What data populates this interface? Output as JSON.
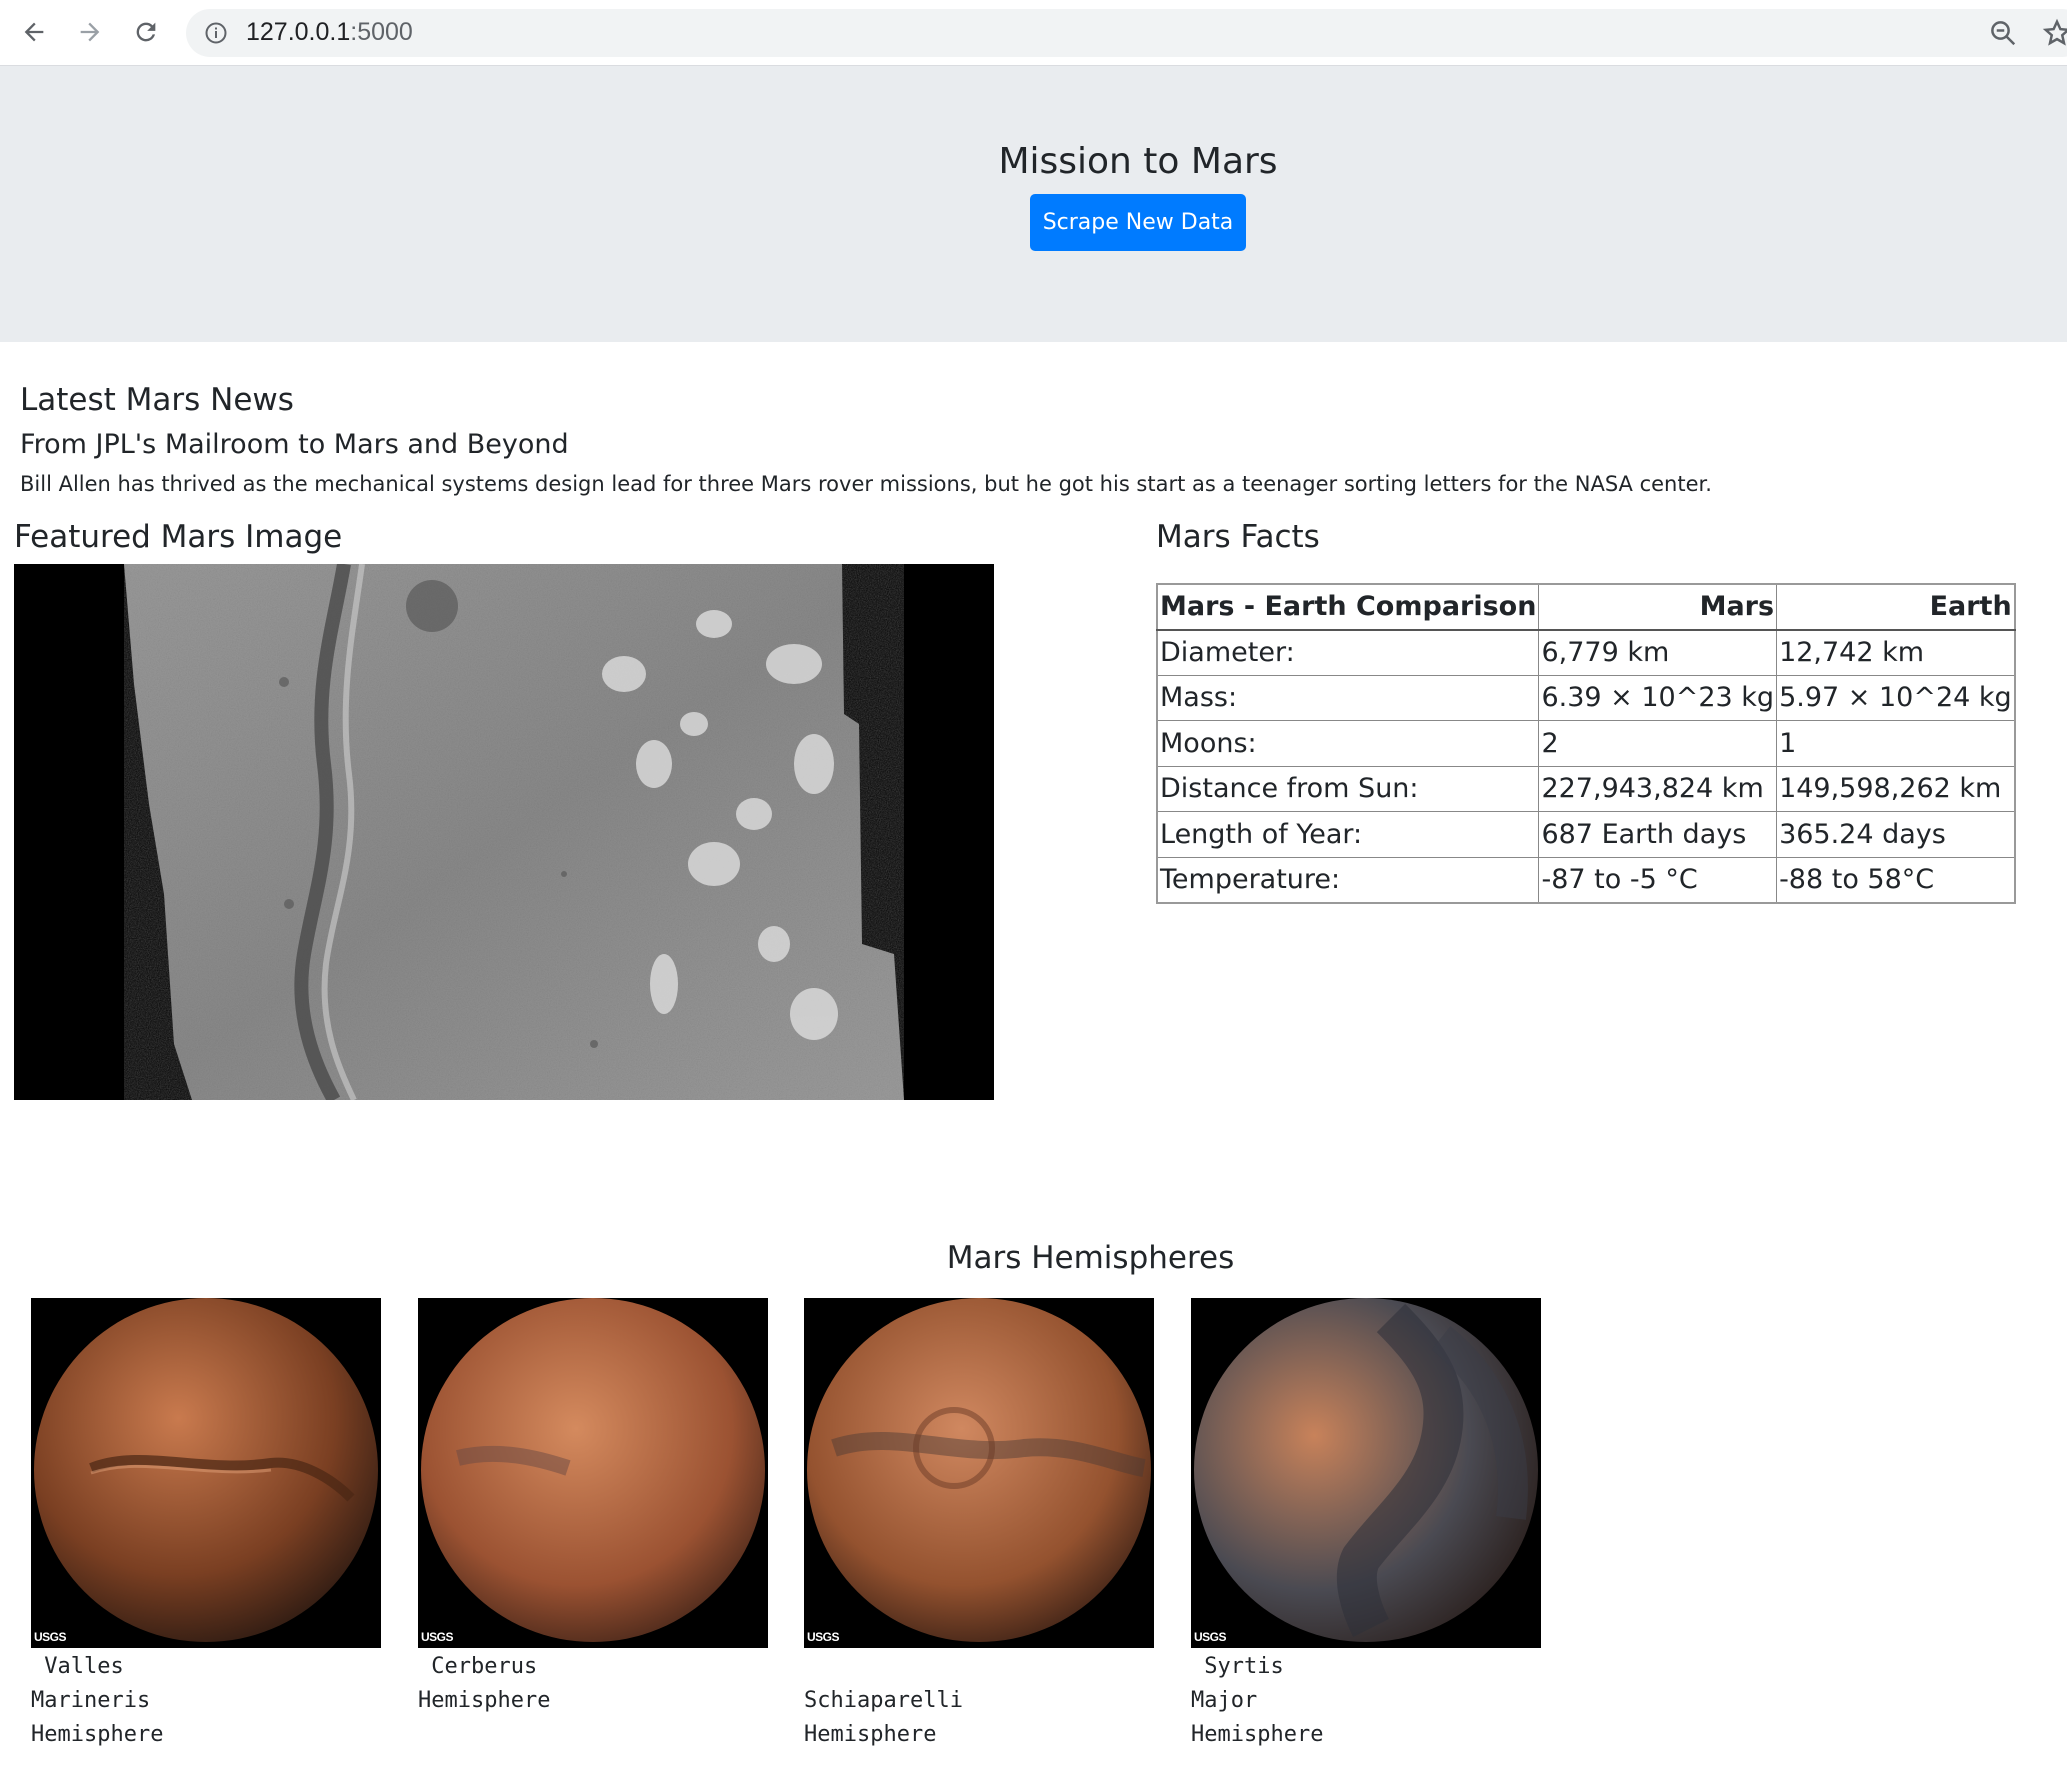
{
  "browser": {
    "url_host": "127.0.0.1",
    "url_port": ":5000"
  },
  "jumbotron": {
    "title": "Mission to Mars",
    "button_label": "Scrape New Data"
  },
  "news": {
    "heading": "Latest Mars News",
    "title": "From JPL's Mailroom to Mars and Beyond",
    "paragraph": "Bill Allen has thrived as the mechanical systems design lead for three Mars rover missions, but he got his start as a teenager sorting letters for the NASA center."
  },
  "featured": {
    "heading": "Featured Mars Image"
  },
  "facts": {
    "heading": "Mars Facts",
    "columns": [
      "Mars - Earth Comparison",
      "Mars",
      "Earth"
    ],
    "rows": [
      [
        "Diameter:",
        "6,779 km",
        "12,742 km"
      ],
      [
        "Mass:",
        "6.39 × 10^23 kg",
        "5.97 × 10^24 kg"
      ],
      [
        "Moons:",
        "2",
        "1"
      ],
      [
        "Distance from Sun:",
        "227,943,824 km",
        "149,598,262 km"
      ],
      [
        "Length of Year:",
        "687 Earth days",
        "365.24 days"
      ],
      [
        "Temperature:",
        "-87 to -5 °C",
        "-88 to 58°C"
      ]
    ]
  },
  "hemispheres": {
    "heading": "Mars Hemispheres",
    "usgs_label": "USGS",
    "items": [
      {
        "title": " Valles\nMarineris\nHemisphere",
        "colors": [
          "#c97a4e",
          "#7a3f22",
          "#2c1a12"
        ]
      },
      {
        "title": " Cerberus\nHemisphere",
        "colors": [
          "#d48a5e",
          "#9b5232",
          "#3a2016"
        ]
      },
      {
        "title": "\nSchiaparelli\nHemisphere",
        "colors": [
          "#d08860",
          "#94522f",
          "#2f1a12"
        ]
      },
      {
        "title": " Syrtis\nMajor\nHemisphere",
        "colors": [
          "#c8825a",
          "#4a4a52",
          "#261a16"
        ]
      }
    ]
  }
}
